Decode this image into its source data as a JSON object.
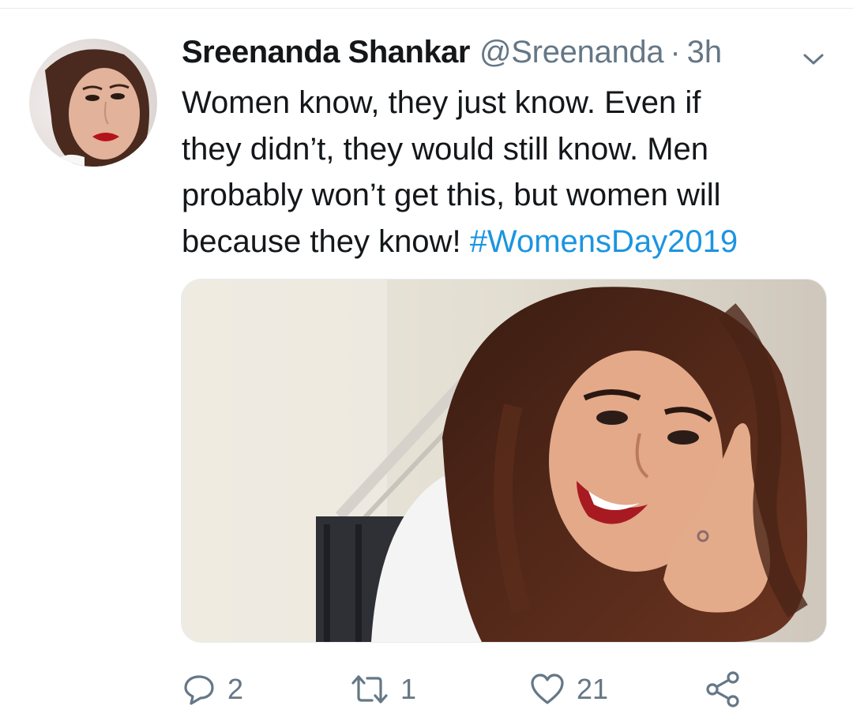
{
  "tweet": {
    "author": {
      "display_name": "Sreenanda Shankar",
      "handle": "@Sreenanda",
      "separator": "·",
      "time": "3h"
    },
    "text_lines": [
      "Women know, they just know. Even if",
      "they didn’t, they would still know. Men",
      "probably won’t get this, but women will"
    ],
    "last_line_text": "because they know!",
    "hashtag": "#WomensDay2019",
    "hashtag_color": "#1b95e0",
    "media_alt": "photo",
    "actions": {
      "reply_count": "2",
      "retweet_count": "1",
      "like_count": "21"
    },
    "icons": {
      "menu": "chevron-down-icon",
      "reply": "reply-icon",
      "retweet": "retweet-icon",
      "like": "heart-icon",
      "share": "share-icon"
    }
  },
  "colors": {
    "text": "#14171a",
    "secondary": "#657786",
    "link": "#1b95e0"
  }
}
